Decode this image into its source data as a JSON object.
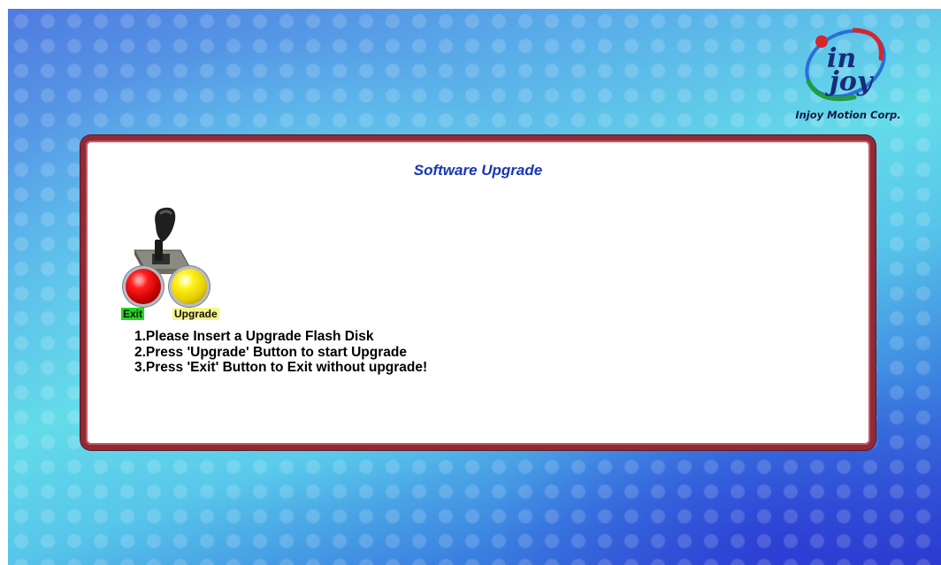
{
  "brand": {
    "logo_mark": "in joy",
    "company_name": "Injoy Motion Corp."
  },
  "dialog": {
    "title": "Software Upgrade",
    "controls": {
      "exit_label": "Exit",
      "upgrade_label": "Upgrade",
      "exit_color": "#ff1e1e",
      "upgrade_color": "#fff21a",
      "joystick_icon": "joystick-icon"
    },
    "instructions": [
      "1.Please Insert a Upgrade Flash Disk",
      "2.Press 'Upgrade' Button to start Upgrade",
      "3.Press 'Exit' Button to Exit without upgrade!"
    ]
  },
  "colors": {
    "title_blue": "#1636b8",
    "panel_border": "#8e2b36",
    "exit_label_bg": "#1fd81f",
    "upgrade_label_bg": "#f5f58a"
  }
}
